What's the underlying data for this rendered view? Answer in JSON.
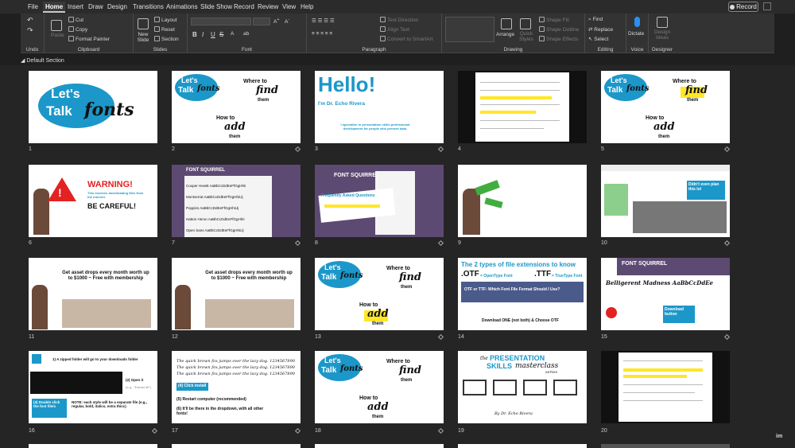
{
  "menu": {
    "tabs": [
      "File",
      "Home",
      "Insert",
      "Draw",
      "Design",
      "Transitions",
      "Animations",
      "Slide Show",
      "Record",
      "Review",
      "View",
      "Help"
    ],
    "active": "Home",
    "record_label": "Record"
  },
  "ribbon": {
    "undo": {
      "label": "Undo"
    },
    "clipboard": {
      "label": "Clipboard",
      "paste": "Paste",
      "cut": "Cut",
      "copy": "Copy",
      "format_painter": "Format Painter"
    },
    "slides": {
      "label": "Slides",
      "new_slide": "New Slide",
      "layout": "Layout",
      "reset": "Reset",
      "section": "Section"
    },
    "font": {
      "label": "Font",
      "bold": "B",
      "italic": "I",
      "underline": "U",
      "strike": "S"
    },
    "paragraph": {
      "label": "Paragraph",
      "text_direction": "Text Direction",
      "align_text": "Align Text",
      "smartart": "Convert to SmartArt"
    },
    "drawing": {
      "label": "Drawing",
      "arrange": "Arrange",
      "quick_styles": "Quick Styles",
      "shape_fill": "Shape Fill",
      "shape_outline": "Shape Outline",
      "shape_effects": "Shape Effects"
    },
    "editing": {
      "label": "Editing",
      "find": "Find",
      "replace": "Replace",
      "select": "Select"
    },
    "voice": {
      "label": "Voice",
      "dictate": "Dictate"
    },
    "designer": {
      "label": "Designer",
      "design_ideas": "Design Ideas"
    }
  },
  "section": {
    "title": "Default Section"
  },
  "slides": [
    {
      "num": "1"
    },
    {
      "num": "2"
    },
    {
      "num": "3"
    },
    {
      "num": "4"
    },
    {
      "num": "5"
    },
    {
      "num": "6"
    },
    {
      "num": "7"
    },
    {
      "num": "8"
    },
    {
      "num": "9"
    },
    {
      "num": "10"
    },
    {
      "num": "11"
    },
    {
      "num": "12"
    },
    {
      "num": "13"
    },
    {
      "num": "14"
    },
    {
      "num": "15"
    },
    {
      "num": "16"
    },
    {
      "num": "17"
    },
    {
      "num": "18"
    },
    {
      "num": "19"
    },
    {
      "num": "20"
    }
  ],
  "text": {
    "lets": "Let's",
    "talk": "Talk",
    "fonts": "fonts",
    "where_to": "Where to",
    "find": "find",
    "them": "them",
    "how_to": "How to",
    "add": "add",
    "hello": "Hello!",
    "im": "I'm Dr. Echo Rivera",
    "s3_body": "I specialize in presentation skills professional development for people who present data.",
    "warning": "WARNING!",
    "s6_body": "This involves downloading files from the internet.",
    "be_careful": "BE CAREFUL!",
    "font_squirrel": "FONT SQUIRREL",
    "s7_f1": "Cooper Hewitt AaBbCcDdEeFfGgHhIi",
    "s7_f2": "Montserrat AaBbCcDdEeFfGgHhIiJj",
    "s7_f3": "Poppins AaBbCcDdEeFfGgHhIiJj",
    "s7_f4": "Hatton Heron AaBbCcDdEeFfGgHhIi",
    "s7_f5": "Open Sans AaBbCcDdEeFfGgHhIiJj",
    "faq": "Frequently Asked Questions",
    "didnt_even": "Didn't even plan this lol",
    "asset_drops": "Get asset drops every month worth up to $1000 ~ Free with membership",
    "two_types": "The 2 types of file extensions to know",
    "otf": ".OTF",
    ".ttf_label": "",
    "otf_desc": "= OpenType Font",
    "ttf": ".TTF",
    "ttf_desc": "= TrueType Font",
    "otf_q": "OTF or TTF: Which Font File Format Should I Use?",
    "download_one": "Download ONE (not both) & Choose OTF",
    "belligerent": "Belligerent Madness AaBbCcDdEe",
    "download_button": "Download button",
    "s16_1": "1) A zipped folder will go to your downloads folder",
    "s16_2": "(2) Open it",
    "s16_extract": "(e.g., \"Extract all\")",
    "s16_3": "(3) Double click the font file/s",
    "s16_note": "NOTE: each style will be a separate file (e.g., regular, bold, italics, extra thicc)",
    "quick_fox": "The quick brown fox jumps over the lazy dog. 1234567890",
    "s17_4": "(4) Click install",
    "s17_5": "(5) Restart computer (recommended)",
    "s17_6": "(6) It'll be there in the dropdown, with all other fonts!",
    "the": "the",
    "presentation": "PRESENTATION",
    "skills": "SKILLS",
    "masterclass": "masterclass",
    "series": "series",
    "by_echo": "By Dr. Echo Rivera"
  },
  "watermark": "im"
}
